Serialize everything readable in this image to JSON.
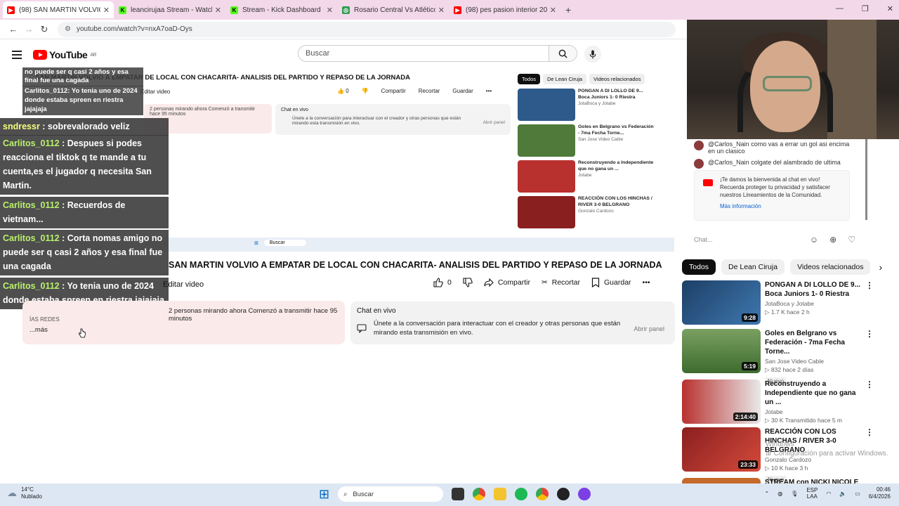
{
  "browser": {
    "tabs": [
      {
        "label": "(98) SAN MARTIN VOLVIO A EM",
        "fav_color": "#ff0000",
        "active": true
      },
      {
        "label": "leancirujaa Stream - Watch Live",
        "fav_color": "#53fc18",
        "active": false
      },
      {
        "label": "Stream - Kick Dashboard",
        "fav_color": "#53fc18",
        "active": false
      },
      {
        "label": "Rosario Central Vs Atlético Tuc",
        "fav_color": "#2e9e4f",
        "active": false
      },
      {
        "label": "(98) pes pasion interior 2026 - Y",
        "fav_color": "#ff0000",
        "active": false
      }
    ],
    "new_tab": "+",
    "url": "youtube.com/watch?v=nxA7oaD-Oys"
  },
  "youtube": {
    "logo_text": "YouTube",
    "region": "AR",
    "search_placeholder": "Buscar"
  },
  "overlay_chat": {
    "top_fragment": "no puede ser q casi 2 años y esa final fue una cagada",
    "top_msg": {
      "user": "Carlitos_0112",
      "text": ": Yo tenia uno de 2024 donde estaba spreen en riestra jajajaja"
    },
    "messages": [
      {
        "user": "sndressr",
        "text": " : sobrevalorado veliz"
      },
      {
        "user": "Carlitos_0112",
        "text": " : Despues si podes reacciona el tiktok q te mande a tu cuenta,es el jugador q necesita San Martin."
      },
      {
        "user": "Carlitos_0112",
        "text": " : Recuerdos de vietnam..."
      },
      {
        "user": "Carlitos_0112",
        "text": " : Corta nomas amigo no puede ser q casi 2 años y esa final fue una cagada"
      },
      {
        "user": "Carlitos_0112",
        "text": " : Yo tenia uno de 2024 donde estaba spreen en riestra jajajaja"
      }
    ]
  },
  "nested": {
    "title": "SAN MARTIN VOLVIO A EMPATAR DE LOCAL CON CHACARITA- ANALISIS DEL PARTIDO Y REPASO DE LA JORNADA",
    "edit": "Editar video",
    "likes": "0",
    "share": "Compartir",
    "clip": "Recortar",
    "save": "Guardar",
    "info": "2 personas mirando ahora  Comenzó a transmitir hace 95 minutos",
    "chat_title": "Chat en vivo",
    "chat_sub": "Únete a la conversación para interactuar con el creador y otras personas que están mirando esta transmisión en vivo.",
    "open_panel": "Abrir panel",
    "taskbar_search": "Buscar"
  },
  "video": {
    "title": "SAN MARTIN VOLVIO A EMPATAR DE LOCAL CON CHACARITA- ANALISIS DEL PARTIDO Y REPASO DE LA JORNADA",
    "title_prefix": "SAN MARTIN VOLVIO",
    "channel": "Lean Cirujía",
    "edit_video": "Editar video",
    "likes": "0",
    "share": "Compartir",
    "clip": "Recortar",
    "save": "Guardar",
    "description_stats": "2 personas mirando ahora  Comenzó a transmitir hace 95 minutos",
    "description_tag": "ÍAS REDES",
    "more": "...más",
    "chat_title": "Chat en vivo",
    "chat_sub": "Únete a la conversación para interactuar con el creador y otras personas que están mirando esta transmisión en vivo.",
    "open_panel": "Abrir panel"
  },
  "recommendations": {
    "chips": [
      "Todos",
      "De Lean Ciruja",
      "Videos relacionados"
    ],
    "items": [
      {
        "title": "PONGAN A DI LOLLO DE 9... Boca Juniors 1- 0 Riestra",
        "channel": "JotaBoca y Jotabe",
        "stats": "▷ 1.7 K  hace 2 h",
        "badge": "",
        "duration": "9:28",
        "thumb": "#2d5a8a"
      },
      {
        "title": "Goles en Belgrano vs Federación - 7ma Fecha Torne...",
        "channel": "San Jose Video Cable",
        "stats": "▷ 832  hace 2 días",
        "badge": "Nuevo",
        "duration": "5:19",
        "thumb": "#4f7a3a"
      },
      {
        "title": "Reconstruyendo a Independiente que no gana un ...",
        "channel": "Jotabe",
        "stats": "▷ 30 K  Transmitido hace 5 m",
        "badge": "",
        "duration": "2:14:40",
        "thumb": "#b8312f"
      },
      {
        "title": "REACCIÓN CON LOS HINCHAS / RIVER 3-0 BELGRANO",
        "channel": "Gonzalo Cardozo",
        "stats": "▷ 10 K  hace 3 h",
        "badge": "Nuevo",
        "duration": "23:33",
        "thumb": "#8a1f1f"
      },
      {
        "title": "STREAM con NICKI NICOLE",
        "channel": "",
        "stats": "",
        "badge": "",
        "duration": "",
        "thumb": "#c46a2a"
      }
    ]
  },
  "kick": {
    "lines": [
      {
        "user": "@Carlos_Nain",
        "text": "como vas a errar un gol asi encima en un clasico"
      },
      {
        "user": "@Carlos_Nain",
        "text": "colgate del alambrado de ultima"
      }
    ],
    "notice": "¡Te damos la bienvenida al chat en vivo! Recuerda proteger tu privacidad y satisfacer nuestros Lineamientos de la Comunidad.",
    "notice_link": "Más información",
    "input_placeholder": "Chat..."
  },
  "taskbar": {
    "temp": "14°C",
    "weather": "Nublado",
    "search": "Buscar",
    "lang": "ESP",
    "lang2": "LAA",
    "time": "00:46",
    "date": "6/4/2026"
  },
  "watermark": {
    "line1": "Windows",
    "line2": "ar Configuración para activar Windows."
  }
}
